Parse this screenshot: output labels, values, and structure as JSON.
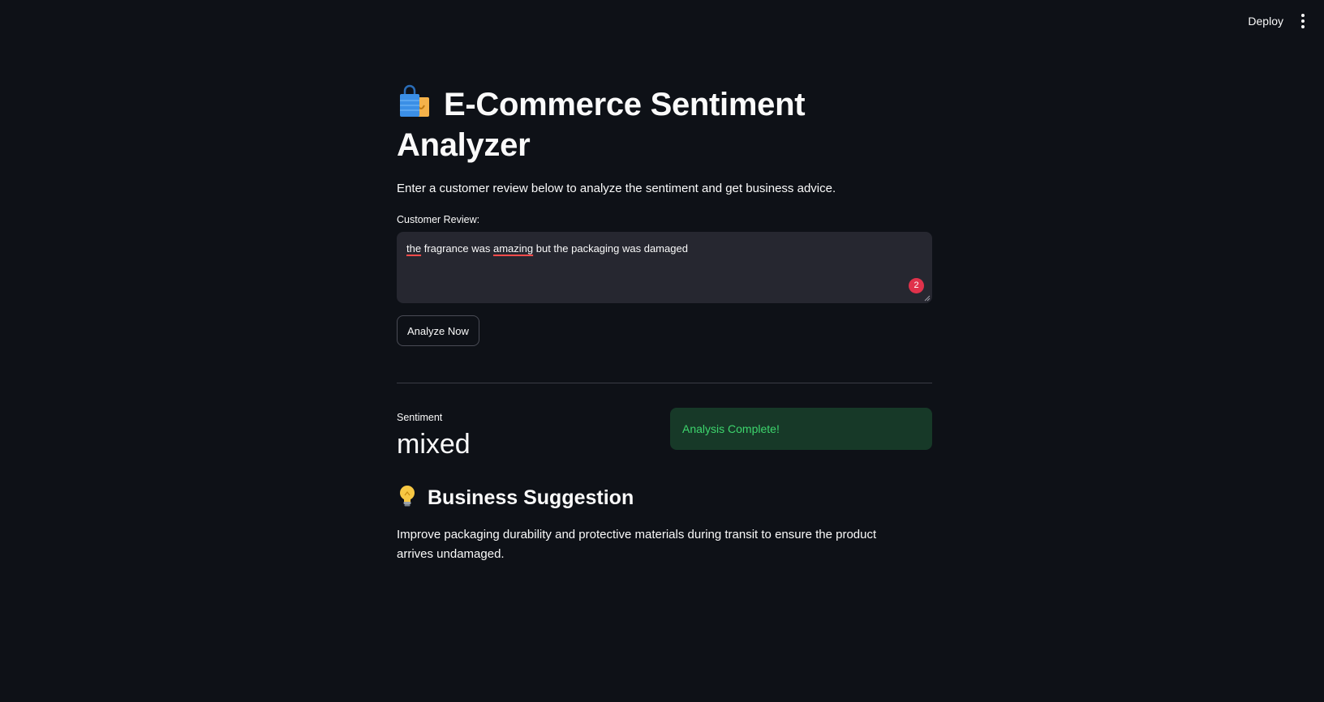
{
  "header": {
    "deploy_label": "Deploy",
    "menu_icon": "kebab-menu-icon"
  },
  "app": {
    "title": "E-Commerce Sentiment Analyzer",
    "title_icon": "shopping-bags-icon",
    "subtitle": "Enter a customer review below to analyze the sentiment and get business advice."
  },
  "review_input": {
    "label": "Customer Review:",
    "value_words": [
      "the",
      "fragrance was",
      "amazing",
      "but the packaging was damaged"
    ],
    "error_count": "2"
  },
  "analyze_button": {
    "label": "Analyze Now"
  },
  "result": {
    "metric_label": "Sentiment",
    "metric_value": "mixed",
    "status_message": "Analysis Complete!"
  },
  "suggestion": {
    "heading": "Business Suggestion",
    "heading_icon": "lightbulb-icon",
    "text": "Improve packaging durability and protective materials during transit to ensure the product arrives undamaged."
  },
  "colors": {
    "background": "#0e1117",
    "input_background": "#262730",
    "success_background": "#173928",
    "success_text": "#3dd56d",
    "error_badge": "#e0324b"
  }
}
